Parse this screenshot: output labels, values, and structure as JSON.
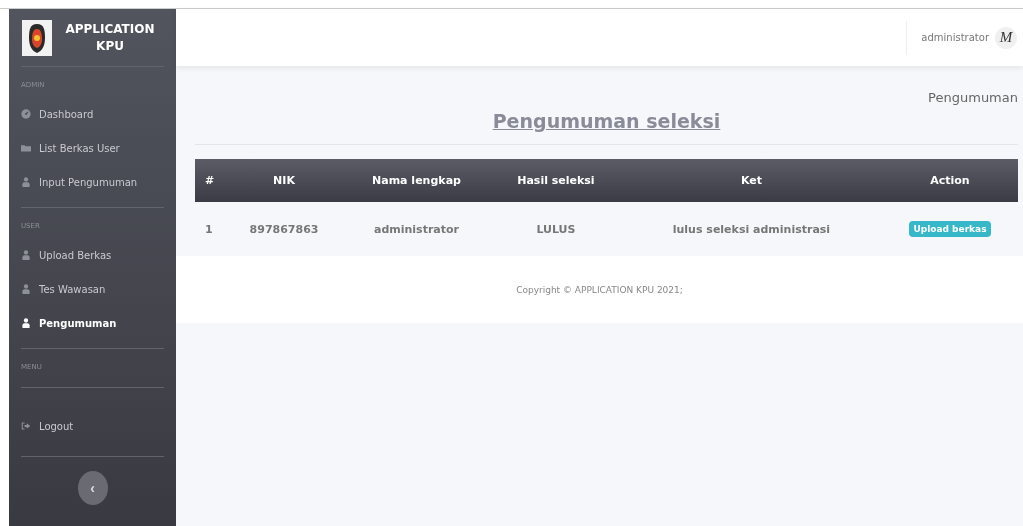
{
  "brand": {
    "title": "APPLICATION KPU"
  },
  "sidebar": {
    "sections": [
      {
        "heading": "ADMIN",
        "items": [
          {
            "label": "Dashboard",
            "kind": "dashboard",
            "selected": false
          },
          {
            "label": "List Berkas User",
            "kind": "folder",
            "selected": false
          },
          {
            "label": "Input Pengumuman",
            "kind": "user",
            "selected": false
          }
        ]
      },
      {
        "heading": "USER",
        "items": [
          {
            "label": "Upload Berkas",
            "kind": "user",
            "selected": false
          },
          {
            "label": "Tes Wawasan",
            "kind": "user",
            "selected": false
          },
          {
            "label": "Pengumuman",
            "kind": "user",
            "selected": true
          }
        ]
      },
      {
        "heading": "MENU"
      }
    ],
    "logout": {
      "label": "Logout"
    },
    "collapse": "‹"
  },
  "header": {
    "user": "administrator",
    "avatar": "M"
  },
  "breadcrumb": "Pengumuman",
  "title": "Pengumuman seleksi",
  "table": {
    "columns": [
      "#",
      "NIK",
      "Nama lengkap",
      "Hasil seleksi",
      "Ket",
      "Action"
    ],
    "rows": [
      {
        "no": "1",
        "nik": "897867863",
        "nama": "administrator",
        "hasil": "LULUS",
        "ket": "lulus seleksi administrasi",
        "action": "Upload berkas"
      }
    ]
  },
  "footer": "Copyright © APPLICATION KPU 2021;"
}
